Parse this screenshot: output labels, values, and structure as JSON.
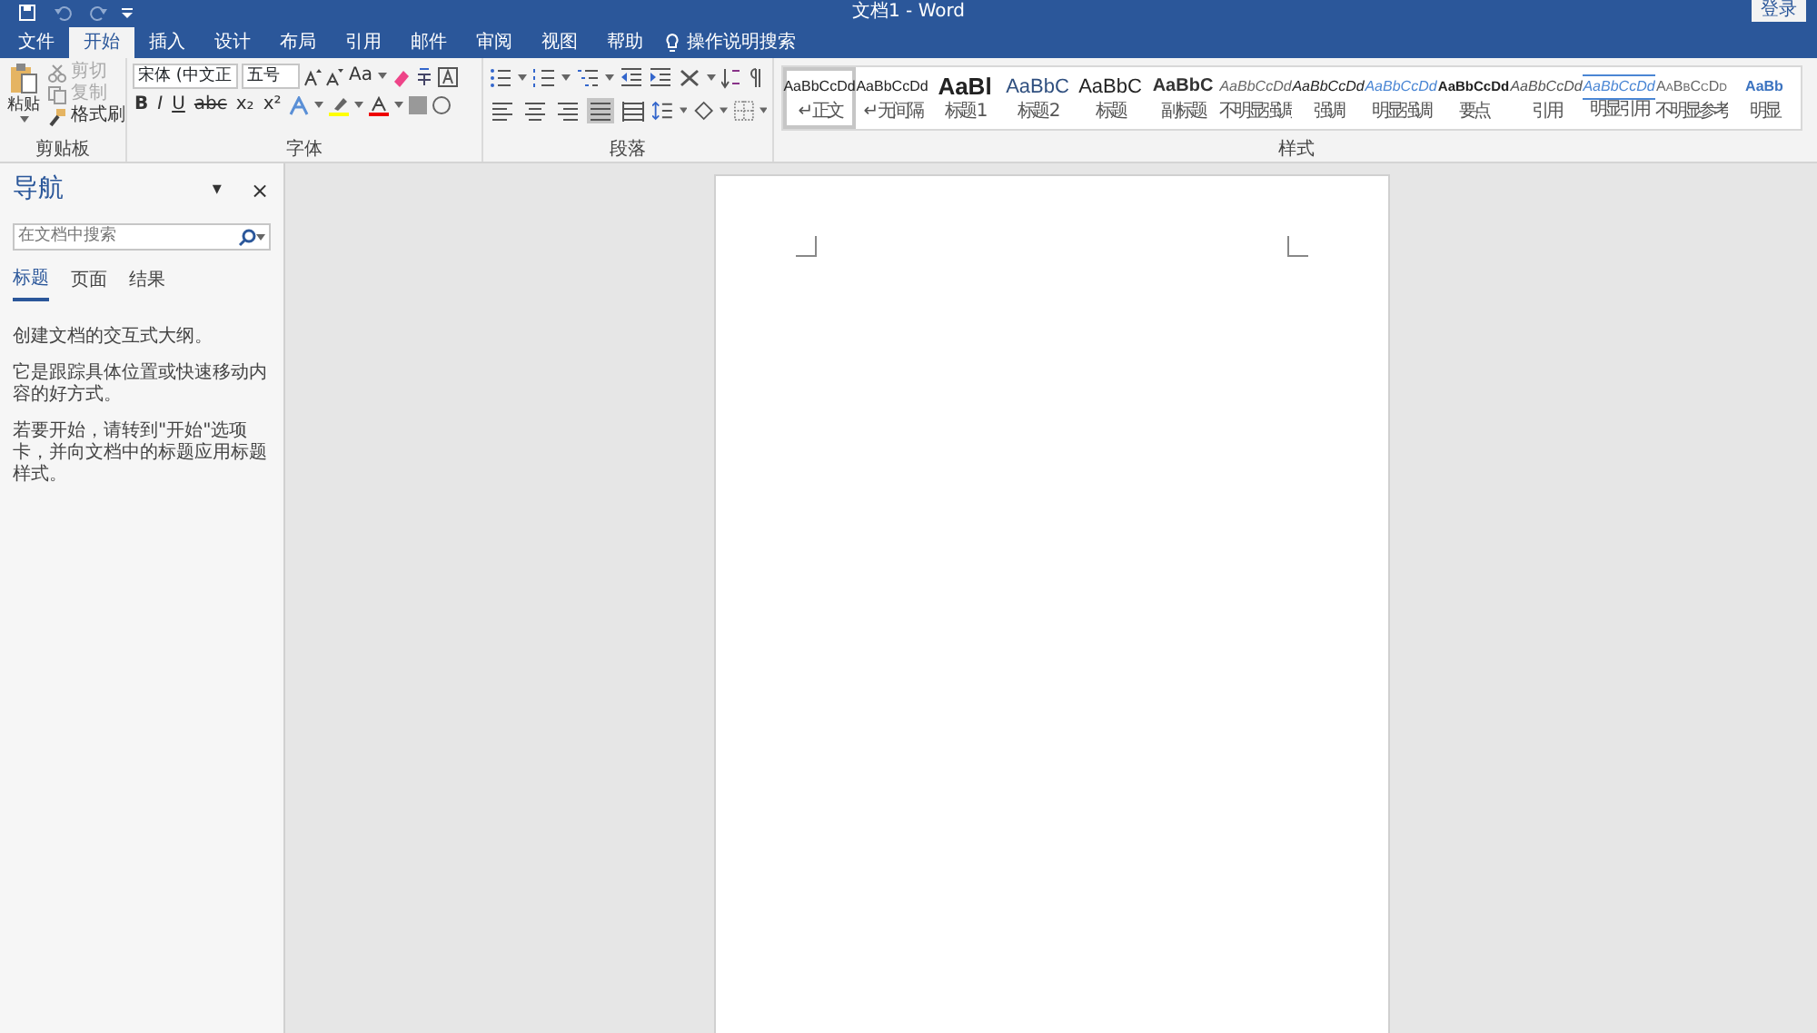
{
  "title_bar": {
    "title": "文档1 - Word",
    "sign_in": "登录"
  },
  "ribbon_tabs": [
    {
      "label": "文件",
      "selected": false
    },
    {
      "label": "开始",
      "selected": true
    },
    {
      "label": "插入",
      "selected": false
    },
    {
      "label": "设计",
      "selected": false
    },
    {
      "label": "布局",
      "selected": false
    },
    {
      "label": "引用",
      "selected": false
    },
    {
      "label": "邮件",
      "selected": false
    },
    {
      "label": "审阅",
      "selected": false
    },
    {
      "label": "视图",
      "selected": false
    },
    {
      "label": "帮助",
      "selected": false
    }
  ],
  "tell_me": "操作说明搜索",
  "clipboard": {
    "paste": "粘贴",
    "cut": {
      "label": "剪切",
      "disabled": true
    },
    "copy": {
      "label": "复制",
      "disabled": true
    },
    "format_painter": {
      "label": "格式刷",
      "disabled": false
    },
    "group_label": "剪贴板"
  },
  "font": {
    "font_name": "宋体 (中文正",
    "font_size": "五号",
    "change_case": "Aa",
    "format_buttons": [
      "B",
      "I",
      "U",
      "abc",
      "x₂",
      "x²"
    ],
    "group_label": "字体"
  },
  "paragraph": {
    "alignments": [
      {
        "kind": "left",
        "selected": false
      },
      {
        "kind": "center",
        "selected": false
      },
      {
        "kind": "right",
        "selected": false
      },
      {
        "kind": "justify",
        "selected": true
      },
      {
        "kind": "distributed",
        "selected": false
      }
    ],
    "group_label": "段落"
  },
  "styles": {
    "items": [
      {
        "preview": "AaBbCcDd",
        "label": "↵ 正文",
        "kind": "normal",
        "selected": true
      },
      {
        "preview": "AaBbCcDd",
        "label": "↵ 无间隔",
        "kind": "normal",
        "selected": false
      },
      {
        "preview": "AaBl",
        "label": "标题 1",
        "kind": "heading1",
        "selected": false
      },
      {
        "preview": "AaBbC",
        "label": "标题 2",
        "kind": "heading2",
        "selected": false
      },
      {
        "preview": "AaBbC",
        "label": "标题",
        "kind": "title",
        "selected": false
      },
      {
        "preview": "AaBbC",
        "label": "副标题",
        "kind": "subtitle",
        "selected": false
      },
      {
        "preview": "AaBbCcDd",
        "label": "不明显强调",
        "kind": "subtle",
        "selected": false
      },
      {
        "preview": "AaBbCcDd",
        "label": "强调",
        "kind": "emphasis",
        "selected": false
      },
      {
        "preview": "AaBbCcDd",
        "label": "明显强调",
        "kind": "intense",
        "selected": false
      },
      {
        "preview": "AaBbCcDd",
        "label": "要点",
        "kind": "strong",
        "selected": false
      },
      {
        "preview": "AaBbCcDd",
        "label": "引用",
        "kind": "quote",
        "selected": false
      },
      {
        "preview": "AaBbCcDd",
        "label": "明显引用",
        "kind": "intense_quote",
        "selected": false
      },
      {
        "preview": "AaBbCcDd",
        "label": "不明显参考",
        "kind": "reference",
        "selected": false
      },
      {
        "preview": "AaBb",
        "label": "明显",
        "kind": "intense_reference",
        "selected": false
      }
    ],
    "group_label": "样式"
  },
  "navigation": {
    "title": "导航",
    "menu": "▾",
    "close": "×",
    "search_placeholder": "在文档中搜索",
    "tabs": [
      {
        "label": "标题",
        "selected": true
      },
      {
        "label": "页面",
        "selected": false
      },
      {
        "label": "结果",
        "selected": false
      }
    ],
    "paragraphs": [
      "创建文档的交互式大纲。",
      "它是跟踪具体位置或快速移动内容的好方式。",
      "若要开始，请转到\"开始\"选项卡，并向文档中的标题应用标题样式。"
    ]
  }
}
